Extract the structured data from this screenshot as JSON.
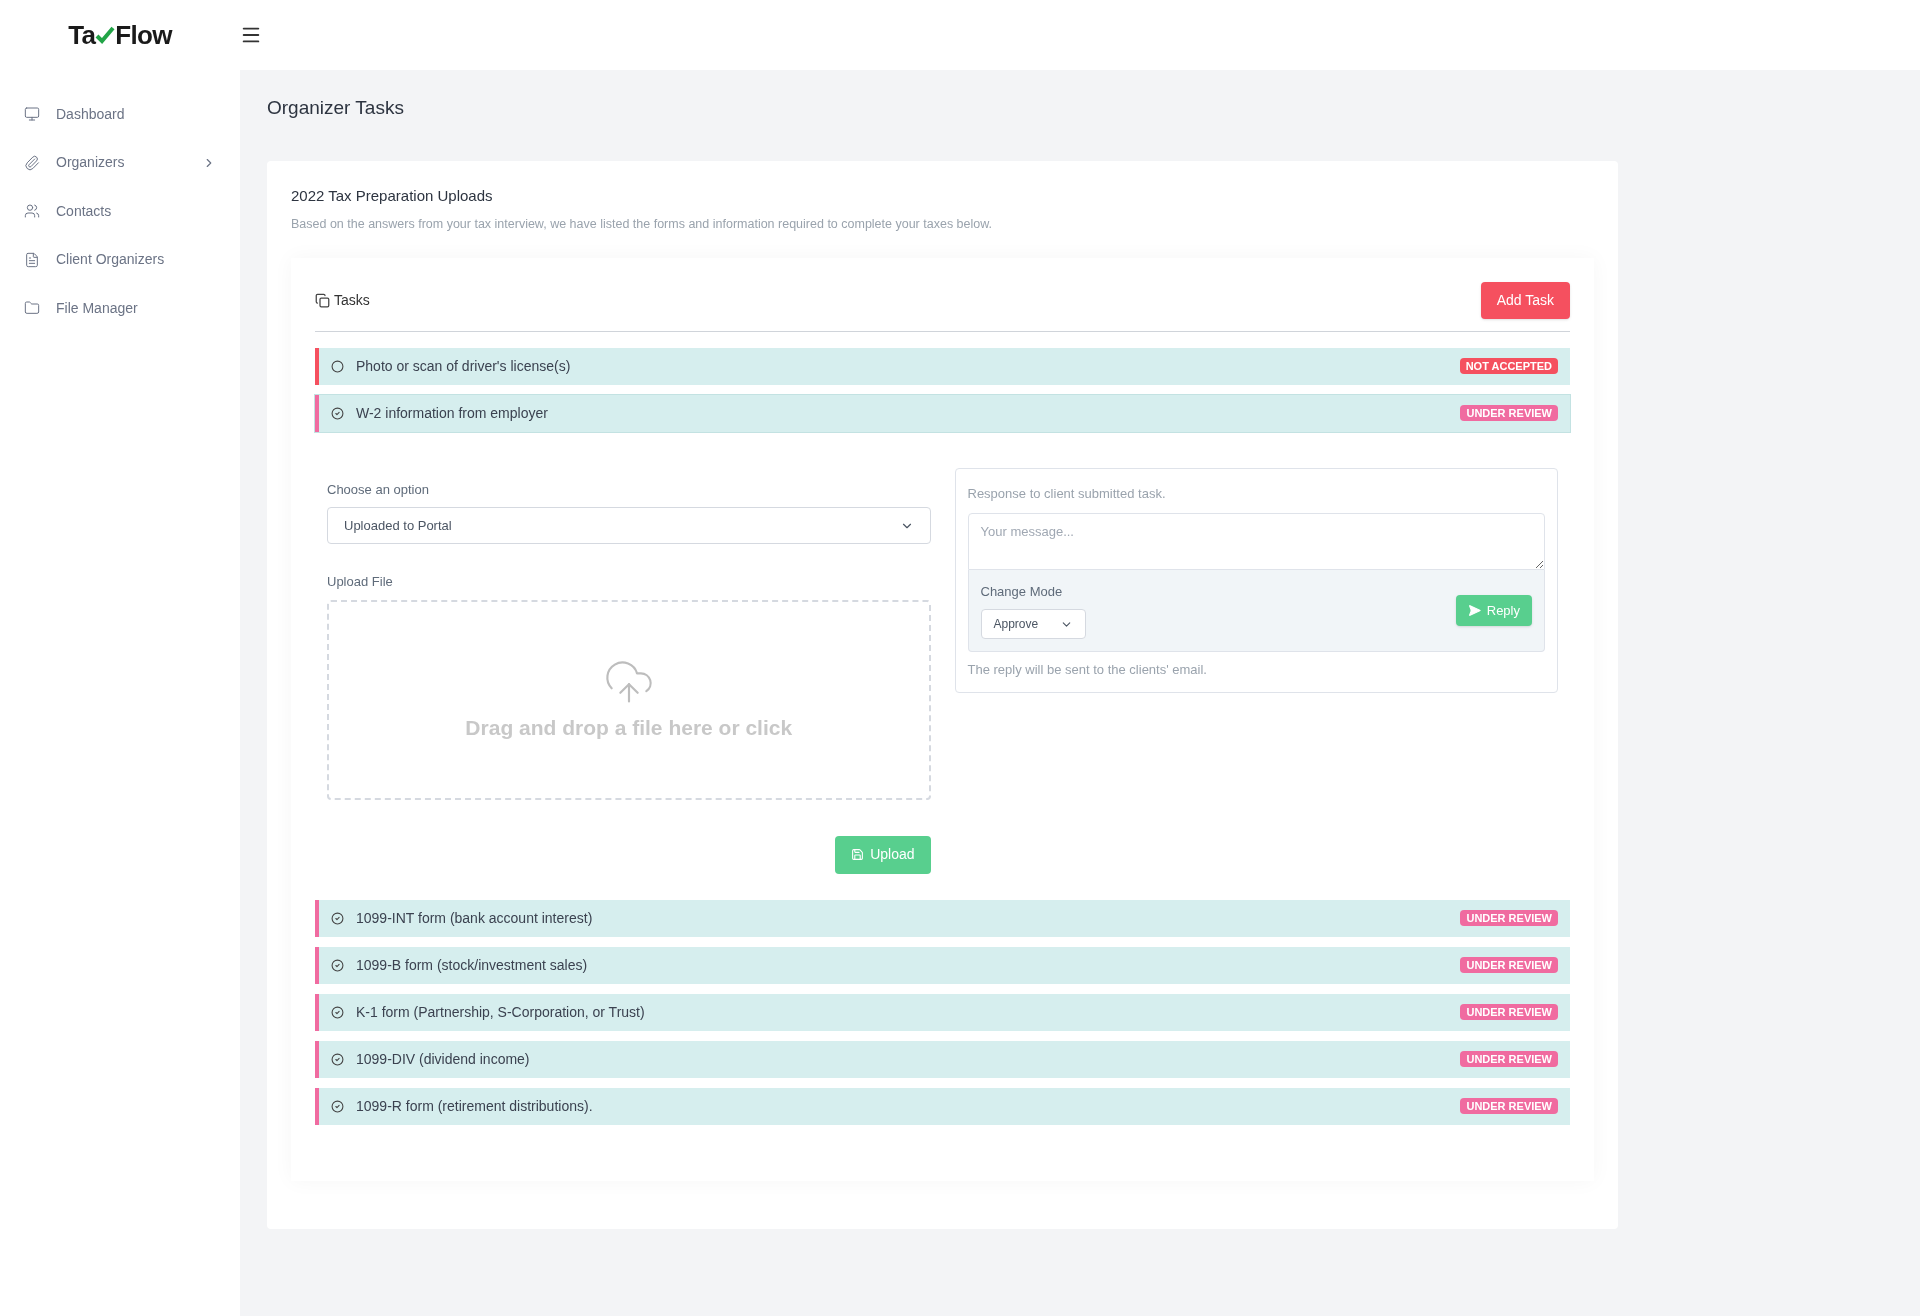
{
  "logo": {
    "before": "Ta",
    "after": "Flow"
  },
  "sidebar": {
    "items": [
      {
        "label": "Dashboard",
        "has_submenu": false
      },
      {
        "label": "Organizers",
        "has_submenu": true
      },
      {
        "label": "Contacts",
        "has_submenu": false
      },
      {
        "label": "Client Organizers",
        "has_submenu": false
      },
      {
        "label": "File Manager",
        "has_submenu": false
      }
    ]
  },
  "page_title": "Organizer Tasks",
  "card": {
    "title": "2022 Tax Preparation Uploads",
    "subtitle": "Based on the answers from your tax interview, we have listed the forms and information required to complete your taxes below."
  },
  "tasks_panel": {
    "title": "Tasks",
    "add_button": "Add Task"
  },
  "tasks": [
    {
      "label": "Photo or scan of driver's license(s)",
      "status": "NOT ACCEPTED",
      "kind": "not_accepted",
      "expanded": false
    },
    {
      "label": "W-2 information from employer",
      "status": "UNDER REVIEW",
      "kind": "under_review",
      "expanded": true
    },
    {
      "label": "1099-INT form (bank account interest)",
      "status": "UNDER REVIEW",
      "kind": "under_review",
      "expanded": false
    },
    {
      "label": "1099-B form (stock/investment sales)",
      "status": "UNDER REVIEW",
      "kind": "under_review",
      "expanded": false
    },
    {
      "label": "K-1 form (Partnership, S-Corporation, or Trust)",
      "status": "UNDER REVIEW",
      "kind": "under_review",
      "expanded": false
    },
    {
      "label": "1099-DIV (dividend income)",
      "status": "UNDER REVIEW",
      "kind": "under_review",
      "expanded": false
    },
    {
      "label": "1099-R form (retirement distributions).",
      "status": "UNDER REVIEW",
      "kind": "under_review",
      "expanded": false
    }
  ],
  "task_detail": {
    "option_label": "Choose an option",
    "option_value": "Uploaded to Portal",
    "upload_label": "Upload File",
    "dropzone_text": "Drag and drop a file here or click",
    "upload_button": "Upload",
    "response_label": "Response to client submitted task.",
    "message_placeholder": "Your message...",
    "mode_label": "Change Mode",
    "mode_value": "Approve",
    "reply_button": "Reply",
    "reply_note": "The reply will be sent to the clients' email."
  }
}
